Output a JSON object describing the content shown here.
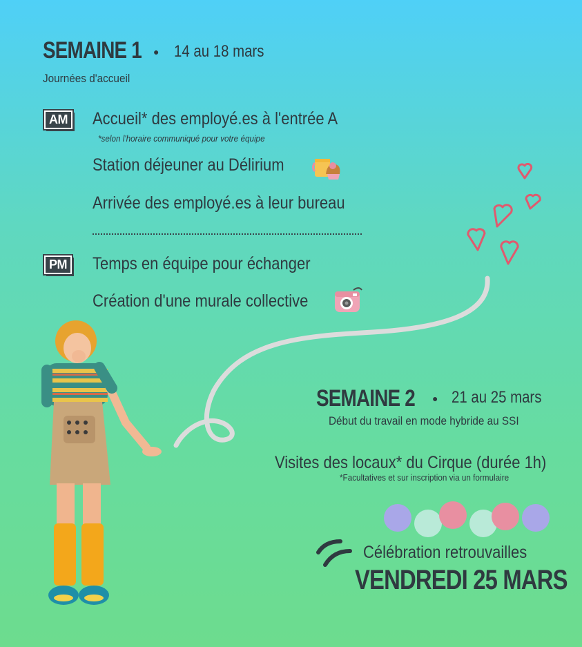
{
  "week1": {
    "title": "SEMAINE 1",
    "dates": "14 au 18 mars",
    "subtitle": "Journées d'accueil",
    "am_badge": "AM",
    "pm_badge": "PM",
    "am_items": [
      "Accueil* des employé.es à l'entrée A",
      "Station déjeuner au Délirium",
      "Arrivée des employé.es à leur bureau"
    ],
    "am_note": "*selon l'horaire communiqué pour votre équipe",
    "pm_items": [
      "Temps en équipe pour échanger",
      "Création d'une murale collective"
    ]
  },
  "week2": {
    "title": "SEMAINE 2",
    "dates": "21 au 25 mars",
    "subtitle": "Début du travail en mode hybride au SSI",
    "visit": "Visites des locaux* du Cirque (durée 1h)",
    "visit_note": "*Facultatives et sur inscription via un formulaire",
    "celebration": "Célébration retrouvailles",
    "celebration_date": "VENDREDI 25 MARS"
  },
  "colors": {
    "text": "#2f3a40",
    "heart": "#e05a6e",
    "balloon_purple": "#a9a7e8",
    "balloon_mint": "#b9ead8",
    "balloon_pink": "#e88fa1"
  }
}
